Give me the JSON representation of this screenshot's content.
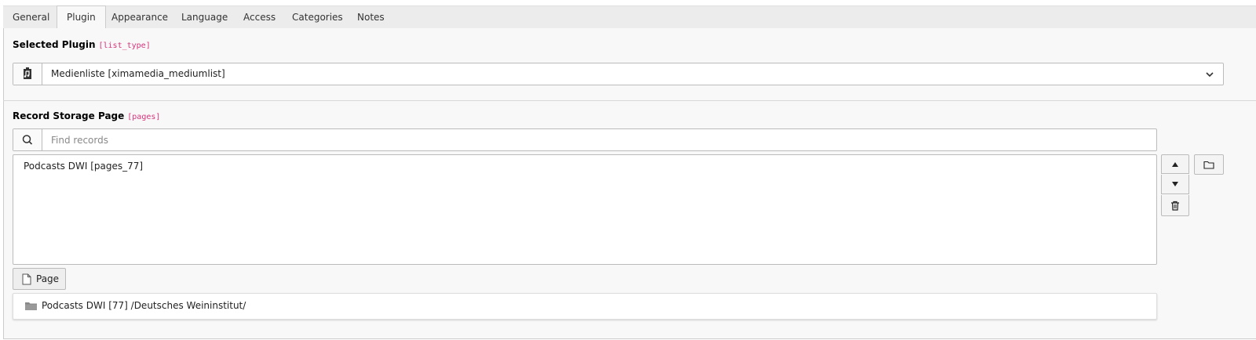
{
  "tabs": [
    {
      "label": "General"
    },
    {
      "label": "Plugin"
    },
    {
      "label": "Appearance"
    },
    {
      "label": "Language"
    },
    {
      "label": "Access"
    },
    {
      "label": "Categories"
    },
    {
      "label": "Notes"
    }
  ],
  "active_tab": "Plugin",
  "plugin": {
    "label": "Selected Plugin",
    "field": "[list_type]",
    "value": "Medienliste [ximamedia_mediumlist]",
    "icon": "plugin-icon"
  },
  "storage": {
    "label": "Record Storage Page",
    "field": "[pages]",
    "search_placeholder": "Find records",
    "items": [
      {
        "label": "Podcasts DWI [pages_77]"
      }
    ],
    "page_button_label": "Page",
    "selected_record": "Podcasts DWI [77] /Deutsches Weininstitut/"
  },
  "colors": {
    "accent": "#d6337a"
  }
}
